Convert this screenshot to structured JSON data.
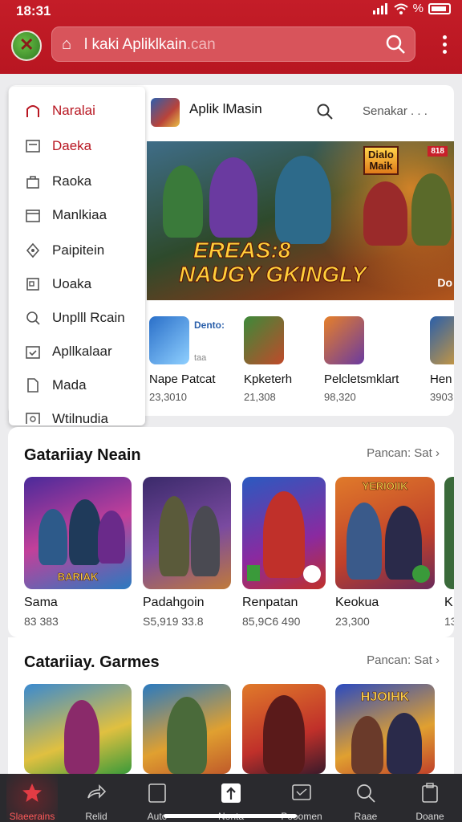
{
  "status_bar": {
    "time": "18:31",
    "battery_symbol": "%"
  },
  "header": {
    "search_text": "l kaki Apliklkain",
    "search_suffix": ".can"
  },
  "store": {
    "title": "Aplik lMasin",
    "more_label": "Senakar . . .",
    "banner": {
      "badge_line1": "Dialo",
      "badge_line2": "Maik",
      "tag": "818",
      "title_line1": "EREAS:8",
      "title_line2": "NAUGY GKINGLY",
      "corner_text": "Do"
    },
    "mini_apps": [
      {
        "name": "Nape Patcat",
        "stat": "23,3010",
        "badge": "Dento:",
        "badge2": "taa"
      },
      {
        "name": "Kpketerh",
        "stat": "21,308"
      },
      {
        "name": "Pelcletsmklart",
        "stat": "98,320"
      },
      {
        "name": "Hen",
        "stat": "3903"
      }
    ]
  },
  "drawer": {
    "items": [
      {
        "label": "Naralai",
        "icon": "home-icon",
        "active": true
      },
      {
        "label": "Daeka",
        "icon": "card-icon",
        "active": true
      },
      {
        "label": "Raoka",
        "icon": "bag-icon",
        "active": false
      },
      {
        "label": "Manlkiaa",
        "icon": "calendar-icon",
        "active": false
      },
      {
        "label": "Paipitein",
        "icon": "location-icon",
        "active": false
      },
      {
        "label": "Uoaka",
        "icon": "book-icon",
        "active": false
      },
      {
        "label": "Unplll Rcain",
        "icon": "search-icon",
        "active": false
      },
      {
        "label": "Apllkalaar",
        "icon": "calendar-check-icon",
        "active": false
      },
      {
        "label": "Mada",
        "icon": "file-icon",
        "active": false
      },
      {
        "label": "Wtilnudia",
        "icon": "image-icon",
        "active": false
      }
    ]
  },
  "sections": [
    {
      "title": "Gatariiay Neain",
      "more": "Pancan: Sat",
      "tiles": [
        {
          "name": "Sama",
          "stat": "83 383",
          "caption": "BARIAK"
        },
        {
          "name": "Padahgoin",
          "stat": "S5,919 33.8",
          "caption": ""
        },
        {
          "name": "Renpatan",
          "stat": "85,9C6 490",
          "caption": ""
        },
        {
          "name": "Keokua",
          "stat": "23,300",
          "caption": "YERIOIIK"
        },
        {
          "name": "K",
          "stat": "13",
          "caption": ""
        }
      ]
    },
    {
      "title": "Catariiay. Garmes",
      "more": "Pancan: Sat",
      "tiles": [
        {
          "caption": ""
        },
        {
          "caption": ""
        },
        {
          "caption": ""
        },
        {
          "caption": "HJOIHK"
        }
      ]
    }
  ],
  "bottom_nav": [
    {
      "label": "Slaeerains",
      "icon": "star-icon",
      "active": true
    },
    {
      "label": "Relid",
      "icon": "share-icon",
      "active": false
    },
    {
      "label": "Auto",
      "icon": "tablet-icon",
      "active": false
    },
    {
      "label": "Nonta",
      "icon": "upload-icon",
      "active": false
    },
    {
      "label": "Pooomen",
      "icon": "monitor-icon",
      "active": false
    },
    {
      "label": "Raae",
      "icon": "search-icon",
      "active": false
    },
    {
      "label": "Doane",
      "icon": "clipboard-icon",
      "active": false
    }
  ],
  "colors": {
    "brand": "#b81621",
    "accent_text": "#b81621",
    "nav_bg": "#2a2a2e"
  }
}
